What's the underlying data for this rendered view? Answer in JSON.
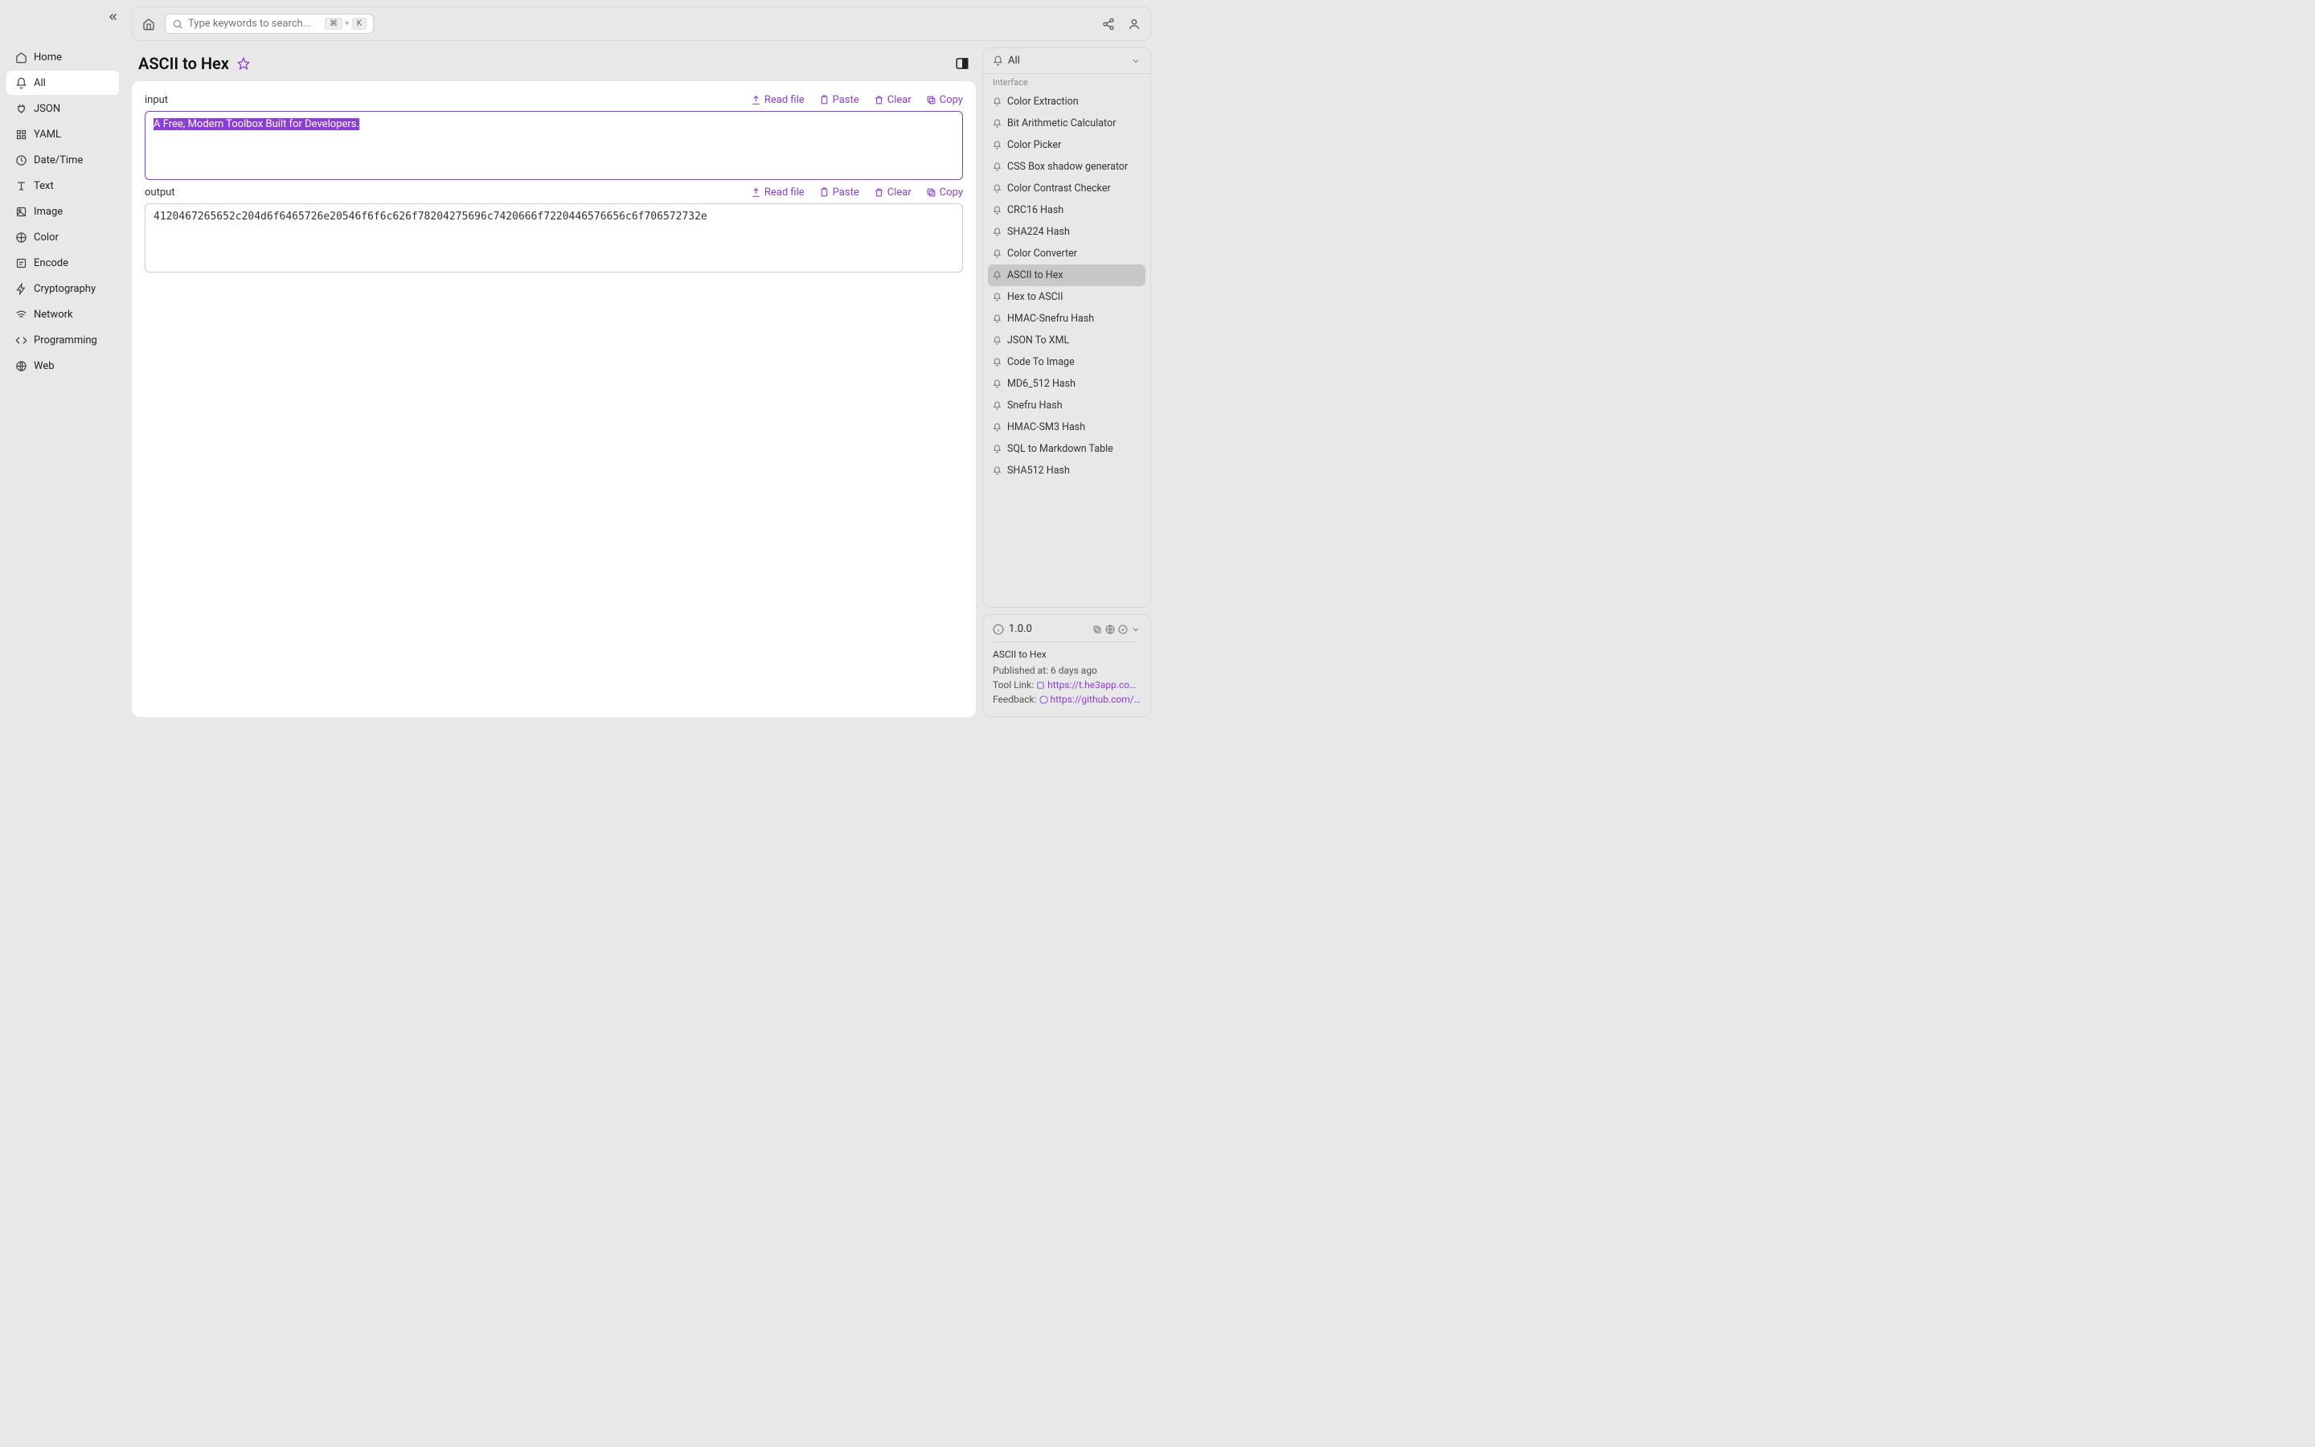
{
  "sidebar": {
    "items": [
      {
        "label": "Home",
        "icon": "home"
      },
      {
        "label": "All",
        "icon": "bell",
        "active": true
      },
      {
        "label": "JSON",
        "icon": "plug"
      },
      {
        "label": "YAML",
        "icon": "grid"
      },
      {
        "label": "Date/Time",
        "icon": "clock"
      },
      {
        "label": "Text",
        "icon": "text"
      },
      {
        "label": "Image",
        "icon": "image"
      },
      {
        "label": "Color",
        "icon": "palette"
      },
      {
        "label": "Encode",
        "icon": "encode"
      },
      {
        "label": "Cryptography",
        "icon": "bolt"
      },
      {
        "label": "Network",
        "icon": "wifi"
      },
      {
        "label": "Programming",
        "icon": "code"
      },
      {
        "label": "Web",
        "icon": "globe"
      }
    ]
  },
  "search": {
    "placeholder": "Type keywords to search...",
    "kbd_cmd": "⌘",
    "kbd_plus": "+",
    "kbd_k": "K"
  },
  "page": {
    "title": "ASCII to Hex"
  },
  "io": {
    "input_label": "input",
    "output_label": "output",
    "input_value": "A Free, Modern Toolbox Built for Developers.",
    "output_value": "4120467265652c204d6f6465726e20546f6f6c626f78204275696c7420666f7220446576656c6f706572732e",
    "actions": {
      "read_file": "Read file",
      "paste": "Paste",
      "clear": "Clear",
      "copy": "Copy"
    }
  },
  "right_panel": {
    "filter_label": "All",
    "partial_top": "Interface",
    "tools": [
      "Color Extraction",
      "Bit Arithmetic Calculator",
      "Color Picker",
      "CSS Box shadow generator",
      "Color Contrast Checker",
      "CRC16 Hash",
      "SHA224 Hash",
      "Color Converter",
      "ASCII to Hex",
      "Hex to ASCII",
      "HMAC-Snefru Hash",
      "JSON To XML",
      "Code To Image",
      "MD6_512 Hash",
      "Snefru Hash",
      "HMAC-SM3 Hash",
      "SQL to Markdown Table",
      "SHA512 Hash"
    ],
    "active_tool": "ASCII to Hex"
  },
  "info": {
    "version": "1.0.0",
    "name": "ASCII to Hex",
    "published_label": "Published at:",
    "published_value": "6 days ago",
    "tool_link_label": "Tool Link:",
    "tool_link_value": "https://t.he3app.co…",
    "feedback_label": "Feedback:",
    "feedback_value": "https://github.com/…"
  },
  "colors": {
    "accent": "#8b3dd6"
  }
}
